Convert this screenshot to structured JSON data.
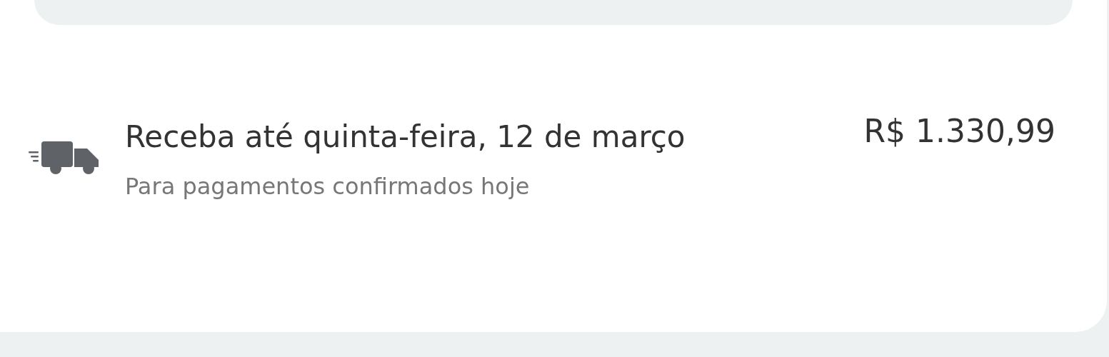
{
  "delivery": {
    "title": "Receba até quinta-feira, 12 de março",
    "subtitle": "Para pagamentos confirmados hoje",
    "price": "R$ 1.330,99"
  }
}
